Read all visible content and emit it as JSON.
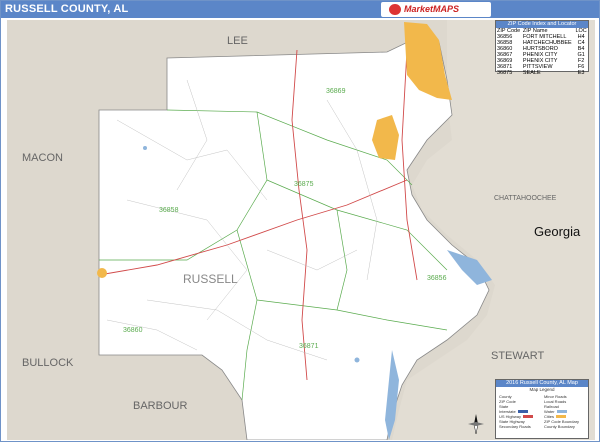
{
  "title": "RUSSELL COUNTY, AL",
  "logo_text": "MarketMAPS",
  "map": {
    "neighbor_labels": {
      "lee": "LEE",
      "macon": "MACON",
      "bullock": "BULLOCK",
      "barbour": "BARBOUR",
      "chattahoochee": "CHATTAHOOCHEE",
      "stewart": "STEWART",
      "georgia": "Georgia"
    },
    "county_label": "RUSSELL",
    "zip_labels": {
      "z36869": "36869",
      "z36875": "36875",
      "z36858": "36858",
      "z36856": "36856",
      "z36860": "36860",
      "z36871": "36871"
    }
  },
  "zip_legend": {
    "header": "ZIP Code Index and Locator",
    "columns": [
      "ZIP Code",
      "ZIP Name",
      "LOC"
    ],
    "rows": [
      [
        "36856",
        "FORT MITCHELL",
        "H4"
      ],
      [
        "36858",
        "HATCHECHUBBEE",
        "C4"
      ],
      [
        "36860",
        "HURTSBORO",
        "B4"
      ],
      [
        "36867",
        "PHENIX CITY",
        "G1"
      ],
      [
        "36869",
        "PHENIX CITY",
        "F2"
      ],
      [
        "36871",
        "PITTSVIEW",
        "F6"
      ],
      [
        "36875",
        "SEALE",
        "E3"
      ]
    ]
  },
  "map_legend": {
    "header": "2016 Russell County, AL Map",
    "subheader": "Map Legend",
    "items": [
      "County",
      "ZIP Code",
      "State",
      "Interstate",
      "US Highway",
      "State Highway",
      "Secondary Roads",
      "Minor Roads",
      "Local Roads",
      "Railroad",
      "Water",
      "Cities",
      "ZIP Code Boundary",
      "County Boundary"
    ]
  },
  "colors": {
    "title_bar": "#5b86c8",
    "county_fill": "#ffffff",
    "neighbor_fill": "#ddd8ce",
    "georgia_fill": "#ddd8ce",
    "city_fill": "#f2b84b",
    "water": "#8fb5dc",
    "zip_boundary": "#5aab4e",
    "road_red": "#d14a4a"
  }
}
